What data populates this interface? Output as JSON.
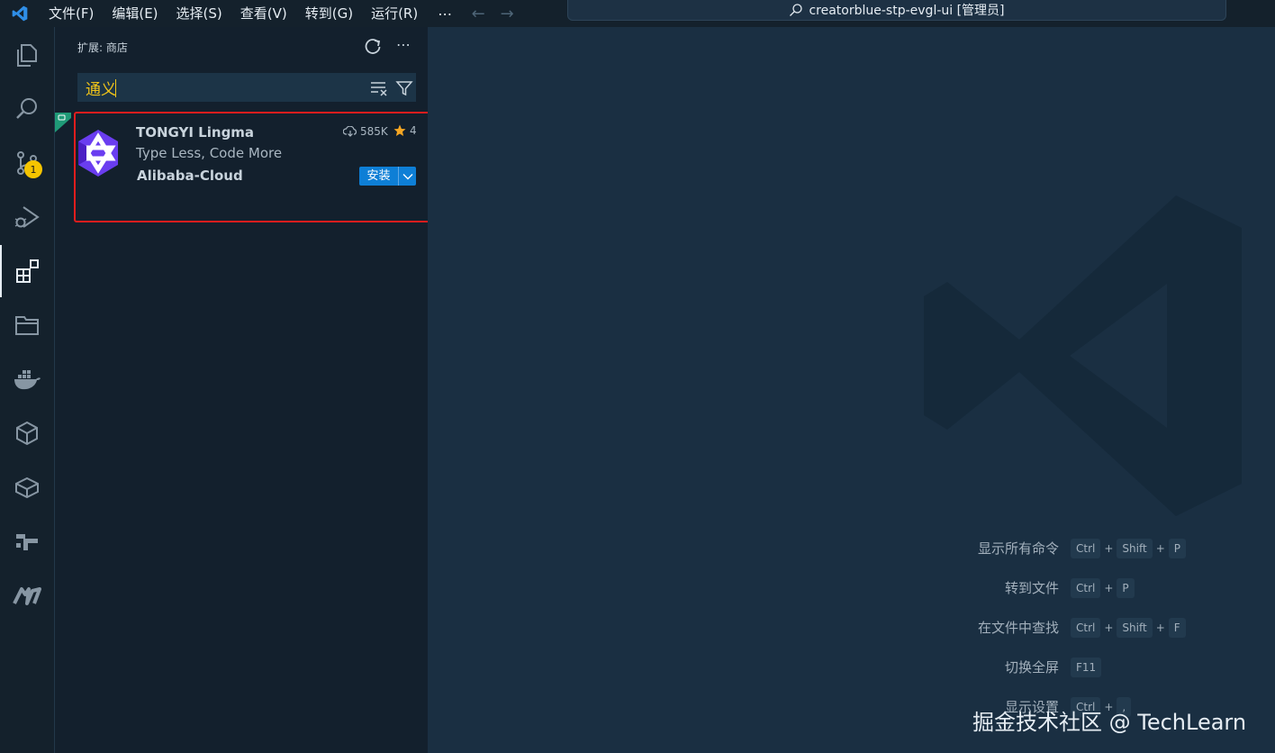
{
  "titlebar": {
    "menu": [
      "文件(F)",
      "编辑(E)",
      "选择(S)",
      "查看(V)",
      "转到(G)",
      "运行(R)"
    ],
    "more": "⋯",
    "command_center": "creatorblue-stp-evgl-ui [管理员]"
  },
  "activitybar": {
    "items": [
      "explorer",
      "search",
      "source-control",
      "run-and-debug",
      "extensions",
      "remote-explorer",
      "docker",
      "package",
      "box",
      "gitlens",
      "mind"
    ],
    "scm_badge": "1"
  },
  "sidebar": {
    "title": "扩展: 商店",
    "search": {
      "value": "通义"
    },
    "extension": {
      "name": "TONGYI Lingma",
      "description": "Type Less, Code More",
      "publisher": "Alibaba-Cloud",
      "downloads": "585K",
      "rating": "4",
      "install_label": "安装"
    }
  },
  "editor": {
    "shortcuts": [
      {
        "label": "显示所有命令",
        "keys": [
          "Ctrl",
          "Shift",
          "P"
        ]
      },
      {
        "label": "转到文件",
        "keys": [
          "Ctrl",
          "P"
        ]
      },
      {
        "label": "在文件中查找",
        "keys": [
          "Ctrl",
          "Shift",
          "F"
        ]
      },
      {
        "label": "切换全屏",
        "keys": [
          "F11"
        ]
      },
      {
        "label": "显示设置",
        "keys": [
          "Ctrl",
          ","
        ]
      }
    ]
  },
  "watermark": "掘金技术社区 @ TechLearn",
  "colors": {
    "accent": "#0e7fd6",
    "highlight": "#e11d1d",
    "search_text": "#f0c419",
    "badge": "#f5c400"
  }
}
